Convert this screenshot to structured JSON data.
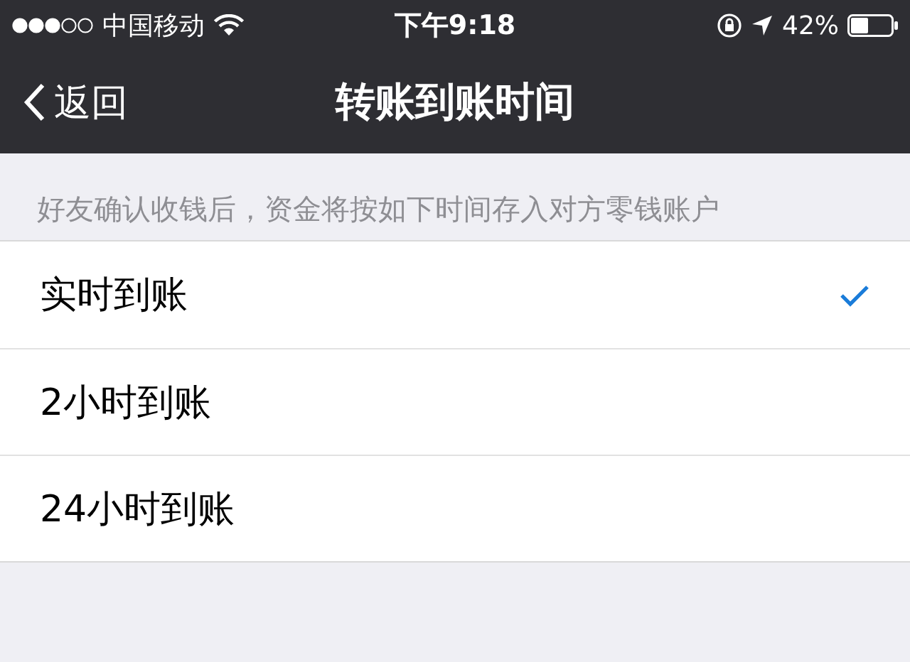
{
  "status_bar": {
    "carrier": "中国移动",
    "time": "下午9:18",
    "battery": "42%"
  },
  "nav": {
    "back": "返回",
    "title": "转账到账时间"
  },
  "hint": "好友确认收钱后，资金将按如下时间存入对方零钱账户",
  "options": [
    {
      "label": "实时到账",
      "selected": true
    },
    {
      "label": "2小时到账",
      "selected": false
    },
    {
      "label": "24小时到账",
      "selected": false
    }
  ]
}
